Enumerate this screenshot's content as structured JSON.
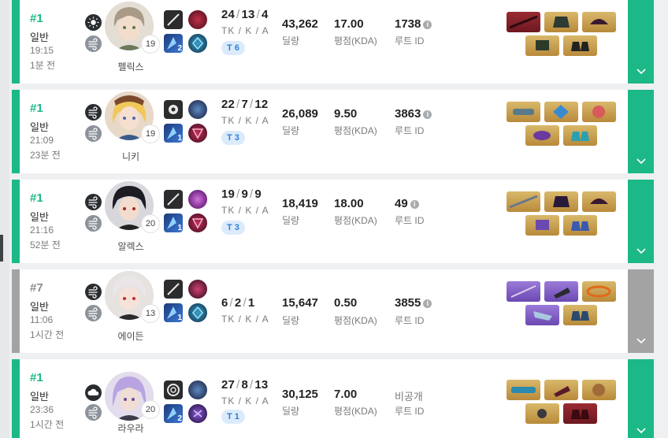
{
  "colors": {
    "win": "#1cb888",
    "lose": "#a3a3a3",
    "tier_badge": "#2f7fd1"
  },
  "kda_label": "TK / K / A",
  "damage_label": "딜량",
  "score_label": "평점(KDA)",
  "route_label": "루트 ID",
  "matches": [
    {
      "result": "win",
      "rank": "#1",
      "mode": "일반",
      "time": "19:15",
      "ago": "1분 전",
      "weather_icon": "sun-icon",
      "character": "펠릭스",
      "level": "19",
      "tactical_level": "2",
      "tk": "24",
      "k": "13",
      "a": "4",
      "tier": "T 6",
      "damage": "43,262",
      "score": "17.00",
      "route": "1738",
      "items": [
        "red",
        "gold",
        "gold",
        "gold",
        "gold"
      ]
    },
    {
      "result": "win",
      "rank": "#1",
      "mode": "일반",
      "time": "21:09",
      "ago": "23분 전",
      "weather_icon": "wind-icon",
      "character": "니키",
      "level": "19",
      "tactical_level": "1",
      "tk": "22",
      "k": "7",
      "a": "12",
      "tier": "T 3",
      "damage": "26,089",
      "score": "9.50",
      "route": "3863",
      "items": [
        "gold",
        "gold",
        "gold",
        "gold",
        "gold"
      ]
    },
    {
      "result": "win",
      "rank": "#1",
      "mode": "일반",
      "time": "21:16",
      "ago": "52분 전",
      "weather_icon": "wind-icon",
      "character": "알렉스",
      "level": "20",
      "tactical_level": "1",
      "tk": "19",
      "k": "9",
      "a": "9",
      "tier": "T 3",
      "damage": "18,419",
      "score": "18.00",
      "route": "49",
      "items": [
        "gold",
        "gold",
        "gold",
        "gold",
        "gold"
      ]
    },
    {
      "result": "lose",
      "rank": "#7",
      "mode": "일반",
      "time": "11:06",
      "ago": "1시간 전",
      "weather_icon": "wind-icon",
      "character": "에이든",
      "level": "13",
      "tactical_level": "1",
      "tk": "6",
      "k": "2",
      "a": "1",
      "tier": "",
      "damage": "15,647",
      "score": "0.50",
      "route": "3855",
      "items": [
        "purple",
        "purple",
        "gold",
        "purple",
        "gold"
      ]
    },
    {
      "result": "win",
      "rank": "#1",
      "mode": "일반",
      "time": "23:36",
      "ago": "1시간 전",
      "weather_icon": "cloud-icon",
      "character": "라우라",
      "level": "20",
      "tactical_level": "2",
      "tk": "27",
      "k": "8",
      "a": "13",
      "tier": "T 1",
      "damage": "30,125",
      "score": "7.00",
      "route": "비공개",
      "items": [
        "gold",
        "gold",
        "gold",
        "gold",
        "red"
      ]
    }
  ]
}
